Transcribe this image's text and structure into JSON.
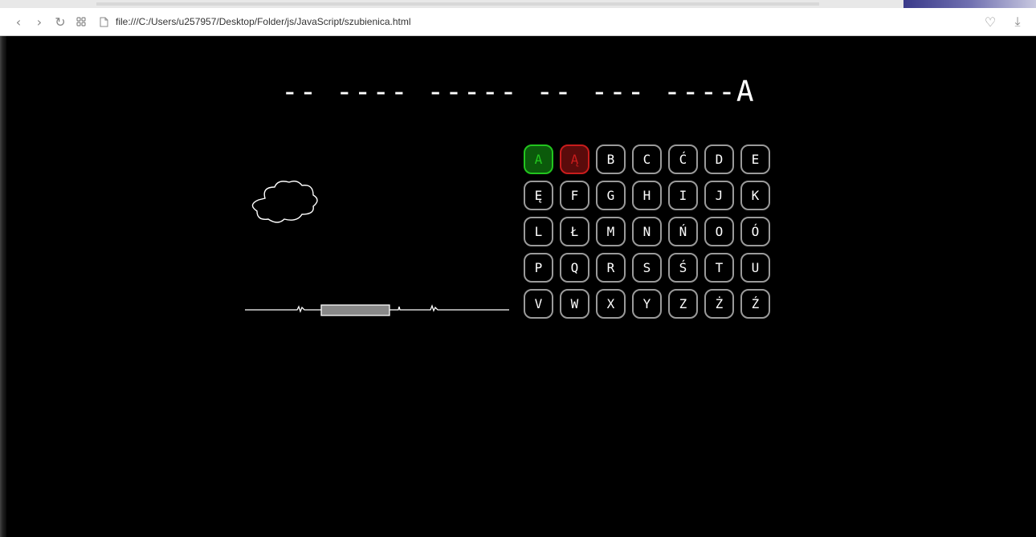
{
  "browser": {
    "url": "file:///C:/Users/u257957/Desktop/Folder/js/JavaScript/szubienica.html",
    "icons": {
      "back": "back-arrow-icon",
      "forward": "forward-arrow-icon",
      "reload": "reload-icon",
      "apps": "apps-grid-icon",
      "page": "page-icon",
      "favorite": "heart-icon",
      "download": "download-icon"
    }
  },
  "game": {
    "phrase": "-- ---- ----- -- --- ----A",
    "keys": [
      {
        "label": "A",
        "state": "correct"
      },
      {
        "label": "Ą",
        "state": "wrong"
      },
      {
        "label": "B",
        "state": "unused"
      },
      {
        "label": "C",
        "state": "unused"
      },
      {
        "label": "Ć",
        "state": "unused"
      },
      {
        "label": "D",
        "state": "unused"
      },
      {
        "label": "E",
        "state": "unused"
      },
      {
        "label": "Ę",
        "state": "unused"
      },
      {
        "label": "F",
        "state": "unused"
      },
      {
        "label": "G",
        "state": "unused"
      },
      {
        "label": "H",
        "state": "unused"
      },
      {
        "label": "I",
        "state": "unused"
      },
      {
        "label": "J",
        "state": "unused"
      },
      {
        "label": "K",
        "state": "unused"
      },
      {
        "label": "L",
        "state": "unused"
      },
      {
        "label": "Ł",
        "state": "unused"
      },
      {
        "label": "M",
        "state": "unused"
      },
      {
        "label": "N",
        "state": "unused"
      },
      {
        "label": "Ń",
        "state": "unused"
      },
      {
        "label": "O",
        "state": "unused"
      },
      {
        "label": "Ó",
        "state": "unused"
      },
      {
        "label": "P",
        "state": "unused"
      },
      {
        "label": "Q",
        "state": "unused"
      },
      {
        "label": "R",
        "state": "unused"
      },
      {
        "label": "S",
        "state": "unused"
      },
      {
        "label": "Ś",
        "state": "unused"
      },
      {
        "label": "T",
        "state": "unused"
      },
      {
        "label": "U",
        "state": "unused"
      },
      {
        "label": "V",
        "state": "unused"
      },
      {
        "label": "W",
        "state": "unused"
      },
      {
        "label": "X",
        "state": "unused"
      },
      {
        "label": "Y",
        "state": "unused"
      },
      {
        "label": "Z",
        "state": "unused"
      },
      {
        "label": "Ż",
        "state": "unused"
      },
      {
        "label": "Ź",
        "state": "unused"
      }
    ],
    "colors": {
      "correct": "#22c51e",
      "wrong": "#c81c1c",
      "keyBorder": "#9a9a9a",
      "background": "#000000"
    }
  }
}
